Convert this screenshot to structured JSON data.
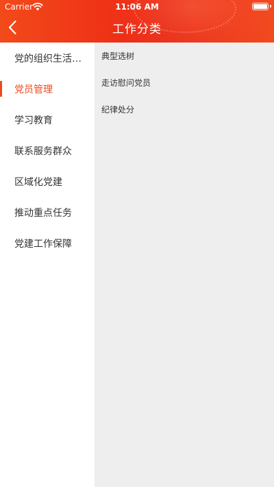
{
  "status_bar": {
    "carrier": "Carrier",
    "time": "11:06 AM"
  },
  "nav": {
    "title": "工作分类",
    "back_icon": "chevron-left-icon"
  },
  "colors": {
    "header_red": "#ee2f16",
    "accent_orange": "#ee4a1c",
    "content_bg": "#eeeeee",
    "text": "#333333"
  },
  "sidebar": {
    "selected_index": 1,
    "items": [
      {
        "label": "党的组织生活…"
      },
      {
        "label": "党员管理"
      },
      {
        "label": "学习教育"
      },
      {
        "label": "联系服务群众"
      },
      {
        "label": "区域化党建"
      },
      {
        "label": "推动重点任务"
      },
      {
        "label": "党建工作保障"
      }
    ]
  },
  "content": {
    "items": [
      {
        "label": "典型选树"
      },
      {
        "label": "走访慰问党员"
      },
      {
        "label": "纪律处分"
      }
    ]
  }
}
